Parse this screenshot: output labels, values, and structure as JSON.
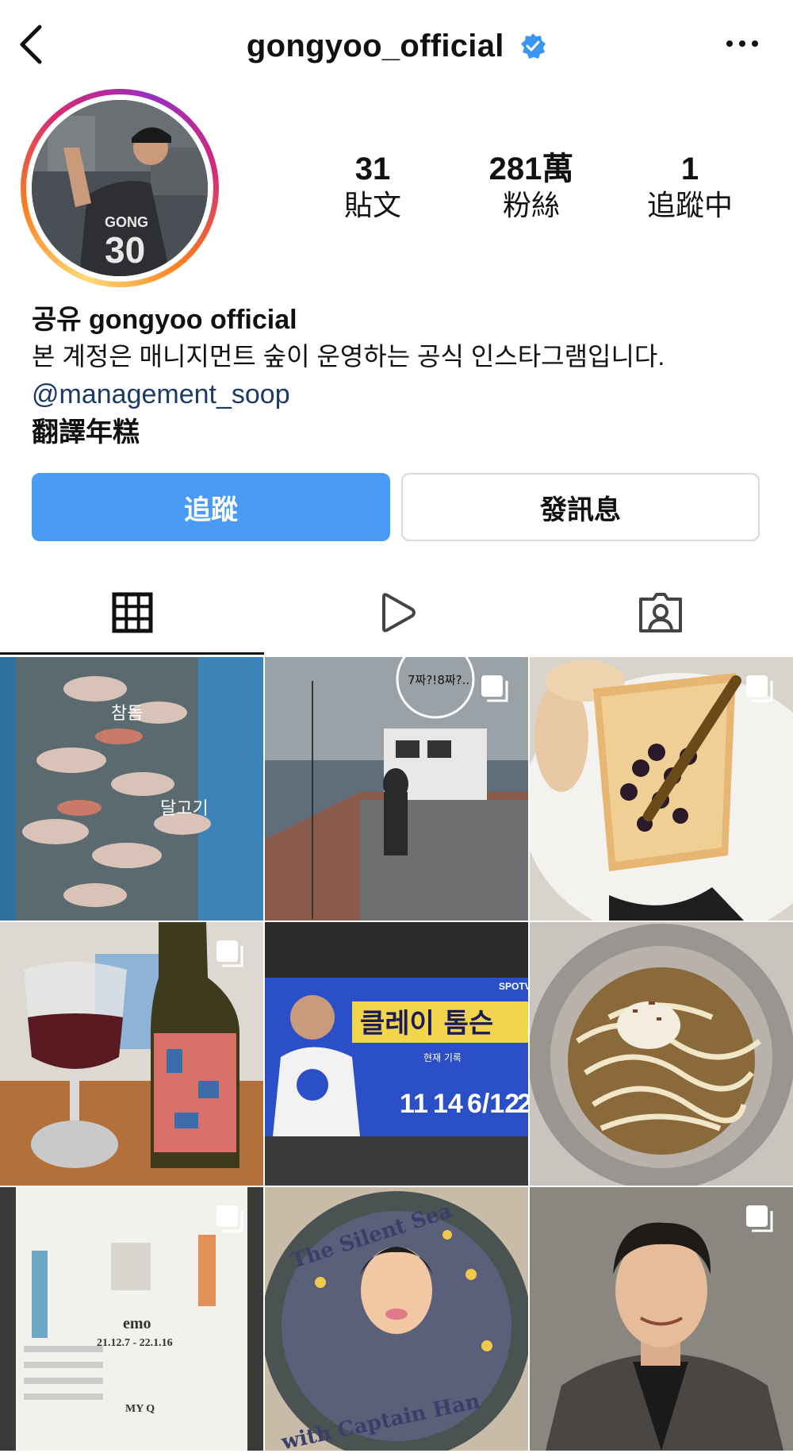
{
  "header": {
    "username": "gongyoo_official"
  },
  "stats": [
    {
      "value": "31",
      "label": "貼文"
    },
    {
      "value": "281萬",
      "label": "粉絲"
    },
    {
      "value": "1",
      "label": "追蹤中"
    }
  ],
  "bio": {
    "full_name": "공유 gongyoo official",
    "description": "본 계정은 매니지먼트 숲이 운영하는 공식 인스타그램입니다.",
    "link": "@management_soop",
    "translate": "翻譯年糕"
  },
  "actions": {
    "follow_label": "追蹤",
    "message_label": "發訊息"
  },
  "colors": {
    "follow_button": "#4a9bf5",
    "verified_badge": "#3897f0",
    "link": "#1d3a66"
  },
  "tabs": [
    {
      "icon": "grid-icon",
      "active": true
    },
    {
      "icon": "reels-icon",
      "active": false
    },
    {
      "icon": "tagged-icon",
      "active": false
    }
  ],
  "posts": [
    {
      "caption_overlay": [
        "참돔",
        "달고기"
      ],
      "multi": false
    },
    {
      "caption_overlay": [
        "7짜?!8짜?.."
      ],
      "multi": true
    },
    {
      "caption_overlay": [],
      "multi": true
    },
    {
      "caption_overlay": [],
      "multi": true
    },
    {
      "caption_overlay": [
        "클레이 톰슨",
        "SPOTV",
        "현재 기록",
        "11",
        "14",
        "6/12",
        "2"
      ],
      "multi": false
    },
    {
      "caption_overlay": [],
      "multi": false
    },
    {
      "caption_overlay": [
        "emo",
        "21.12.7 - 22.1.16",
        "MY Q"
      ],
      "multi": true
    },
    {
      "caption_overlay": [
        "The Silent Sea",
        "with Captain Han"
      ],
      "multi": false
    },
    {
      "caption_overlay": [],
      "multi": true
    }
  ]
}
